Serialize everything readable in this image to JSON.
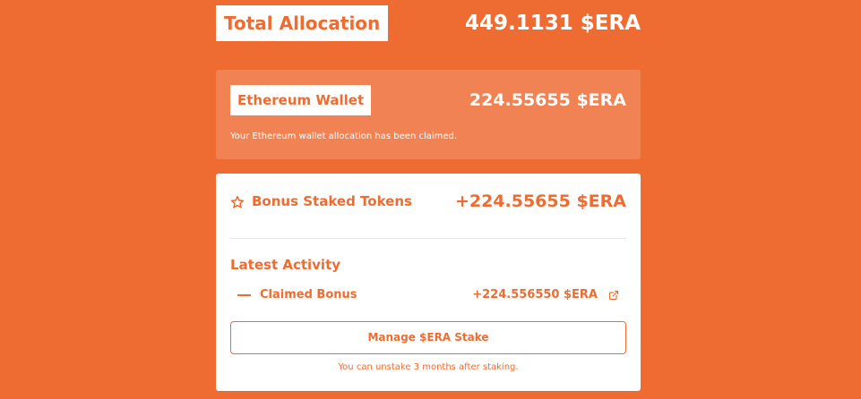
{
  "colors": {
    "page_background": "#ee6c32",
    "accent": "#ee6c32",
    "wallet_card_background": "#f08254",
    "card_background": "#ffffff",
    "divider": "#e9e2de"
  },
  "total_allocation": {
    "label": "Total Allocation",
    "value": "449.1131 $ERA"
  },
  "ethereum_wallet": {
    "label": "Ethereum Wallet",
    "value": "224.55655 $ERA",
    "note": "Your Ethereum wallet allocation has been claimed."
  },
  "bonus": {
    "icon": "star-outline-icon",
    "label": "Bonus Staked Tokens",
    "value": "+224.55655 $ERA"
  },
  "latest_activity": {
    "title": "Latest Activity",
    "items": [
      {
        "icon": "dash-icon",
        "label": "Claimed Bonus",
        "value": "+224.556550 $ERA",
        "link_icon": "external-link-icon"
      }
    ]
  },
  "manage": {
    "button_label": "Manage $ERA Stake",
    "note": "You can unstake 3 months after staking."
  }
}
